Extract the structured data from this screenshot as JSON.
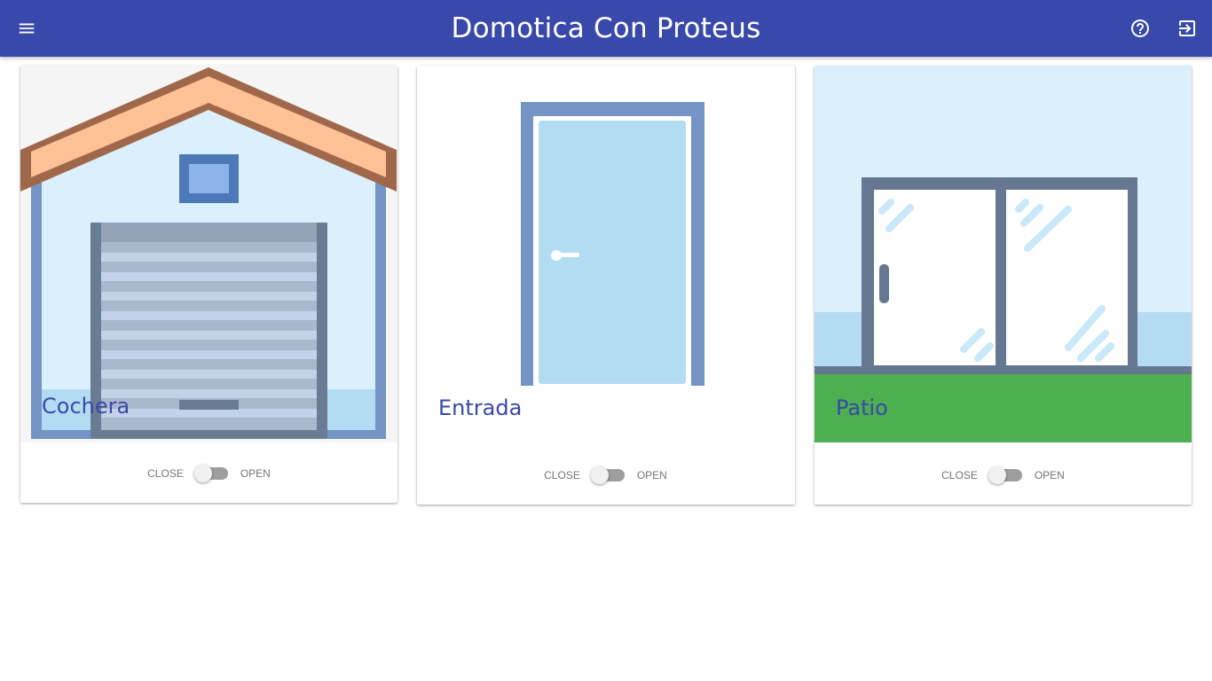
{
  "app": {
    "title": "Domotica Con Proteus",
    "primary_color": "#3949ab",
    "icons": {
      "menu": "menu-icon",
      "help": "help-circle-icon",
      "logout": "exit-to-app-icon"
    }
  },
  "cards": [
    {
      "title": "Cochera",
      "image": "garage-illustration",
      "switch": {
        "off_label": "Close",
        "on_label": "Open",
        "state": "off"
      }
    },
    {
      "title": "Entrada",
      "image": "door-illustration",
      "switch": {
        "off_label": "Close",
        "on_label": "Open",
        "state": "off"
      }
    },
    {
      "title": "Patio",
      "image": "sliding-door-illustration",
      "switch": {
        "off_label": "Close",
        "on_label": "Open",
        "state": "off"
      }
    }
  ]
}
